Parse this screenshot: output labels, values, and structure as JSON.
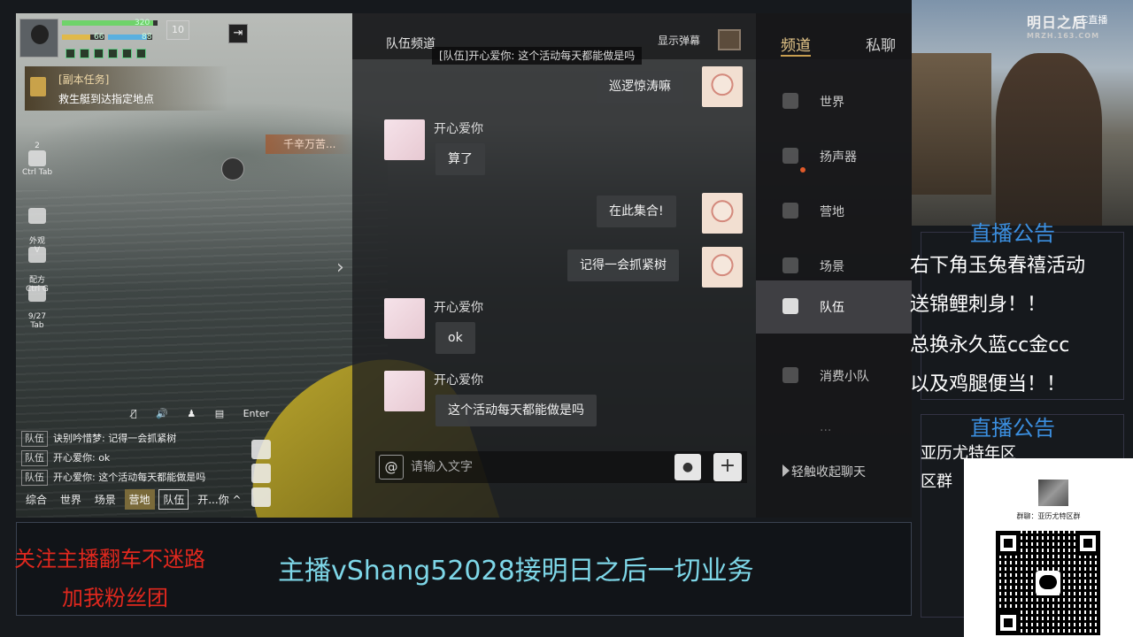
{
  "hud": {
    "hp_value": "320",
    "hp_fill": 0.95,
    "food_value": "66",
    "food_fill": 0.66,
    "water_value": "88",
    "water_fill": 0.88,
    "level": "10"
  },
  "task": {
    "label": "[副本任务]",
    "desc": "救生艇到达指定地点"
  },
  "side_icons": [
    {
      "num": "2",
      "label": "Ctrl Tab"
    },
    {
      "label": "外观\nV"
    },
    {
      "label": "配方\nCtrl G"
    },
    {
      "label": "9/27\nTab"
    }
  ],
  "speaker_text": "千辛万苦...",
  "controls": {
    "enter": "Enter"
  },
  "mini_chat": [
    {
      "tag": "队伍",
      "text": "诀别吟惜梦: 记得一会抓紧树"
    },
    {
      "tag": "队伍",
      "text": "开心爱你: ok"
    },
    {
      "tag": "队伍",
      "text": "开心爱你: 这个活动每天都能做是吗"
    }
  ],
  "mini_tabs": [
    "综合",
    "世界",
    "场景",
    "营地",
    "队伍",
    "开...你 ^"
  ],
  "chat": {
    "title": "队伍频道",
    "danmu_label": "显示弹幕",
    "top_message": "[队伍]开心爱你: 这个活动每天都能做是吗",
    "messages": [
      {
        "side": "right",
        "text": "巡逻惊涛嘛"
      },
      {
        "side": "left",
        "name": "开心爱你",
        "text": "算了"
      },
      {
        "side": "right",
        "text": "在此集合!"
      },
      {
        "side": "right",
        "text": "记得一会抓紧树"
      },
      {
        "side": "left",
        "name": "开心爱你",
        "text": "ok"
      },
      {
        "side": "left",
        "name": "开心爱你",
        "text": "这个活动每天都能做是吗"
      }
    ],
    "input_placeholder": "请输入文字",
    "at_symbol": "@",
    "mic_icon": "mic-icon",
    "plus_symbol": "+"
  },
  "channel_tabs": {
    "channel": "频道",
    "private": "私聊"
  },
  "channels": [
    "世界",
    "扬声器",
    "营地",
    "场景",
    "队伍",
    "消费小队",
    "..."
  ],
  "active_channel": "队伍",
  "collapse_label": "轻触收起聊天",
  "stream": {
    "notice_title": "直播公告",
    "notice_lines": [
      "右下角玉兔春禧活动",
      "送锦鲤刺身！！",
      "总换永久蓝cc金cc",
      "以及鸡腿便当！！"
    ],
    "notice_title2": "直播公告",
    "region_lines": [
      "亚历尤特年区",
      "区群"
    ],
    "qr_group_text": "群聊：亚历尤特区群",
    "logo_text": "明日之后",
    "logo_sub": "MRZH.163.COM",
    "cc_text": "CC直播",
    "banner_red1": "关注主播翻车不迷路",
    "banner_red2": "加我粉丝团",
    "banner_main": "主播vShang52028接明日之后一切业务"
  },
  "colors": {
    "accent_gold": "#c89e4f",
    "notice_blue": "#3b8fe0",
    "banner_red": "#e0281e",
    "banner_cyan": "#7ed7e8"
  }
}
